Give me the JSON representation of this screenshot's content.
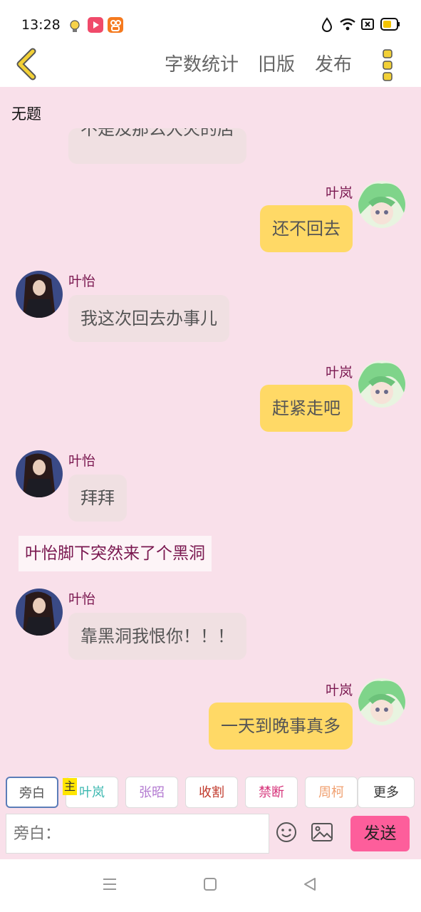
{
  "status_bar": {
    "time": "13:28"
  },
  "topbar": {
    "word_count": "字数统计",
    "old_version": "旧版",
    "publish": "发布"
  },
  "chat": {
    "title": "无题",
    "partial_message": "不是及那么大火的店",
    "messages": [
      {
        "speaker": "叶岚",
        "text": "还不回去"
      },
      {
        "speaker": "叶怡",
        "text": "我这次回去办事儿"
      },
      {
        "speaker": "叶岚",
        "text": "赶紧走吧"
      },
      {
        "speaker": "叶怡",
        "text": "拜拜"
      },
      {
        "narration": "叶怡脚下突然来了个黑洞"
      },
      {
        "speaker": "叶怡",
        "text": "靠黑洞我恨你！！！"
      },
      {
        "speaker": "叶岚",
        "text": "一天到晚事真多"
      }
    ]
  },
  "roles": {
    "host_tag": "主",
    "items": [
      {
        "label": "旁白",
        "color": "#555555"
      },
      {
        "label": "叶岚",
        "color": "#3cb8b0"
      },
      {
        "label": "张昭",
        "color": "#b37ad1"
      },
      {
        "label": "收割",
        "color": "#c0392b"
      },
      {
        "label": "禁断",
        "color": "#d6337a"
      },
      {
        "label": "周柯",
        "color": "#f0a070"
      },
      {
        "label": "更多",
        "color": "#333333"
      }
    ]
  },
  "input": {
    "placeholder": "旁白："
  },
  "send_label": "发送",
  "colors": {
    "background": "#f9e0ea",
    "left_bubble": "#f0e0e2",
    "right_bubble": "#ffd966",
    "name_color": "#7a1850",
    "send_button": "#fd5e9b",
    "back_arrow": "#f2d036"
  }
}
